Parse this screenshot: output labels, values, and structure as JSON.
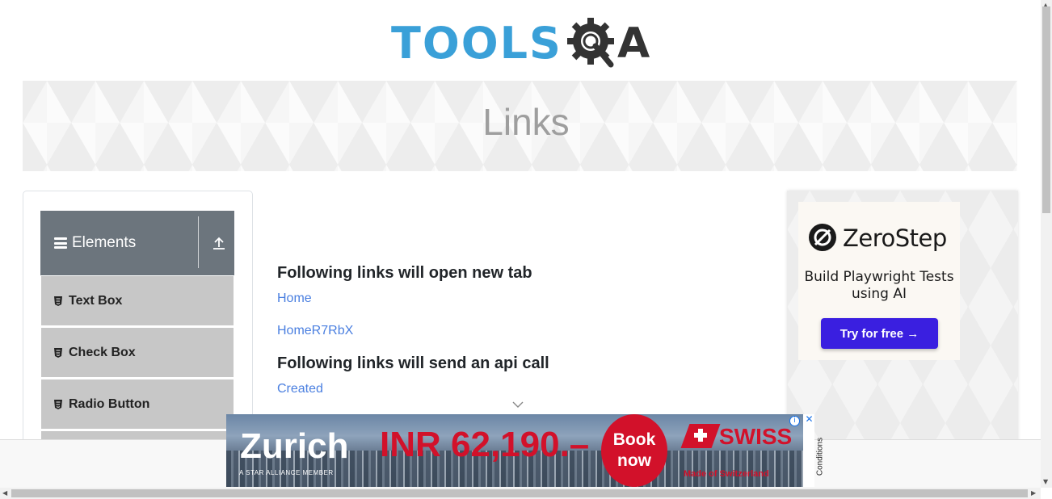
{
  "header": {
    "logo_tools": "TOOLS",
    "logo_a": "A"
  },
  "banner": {
    "title": "Links"
  },
  "sidebar": {
    "group_title": "Elements",
    "items": [
      {
        "label": "Text Box"
      },
      {
        "label": "Check Box"
      },
      {
        "label": "Radio Button"
      }
    ]
  },
  "main": {
    "sections": [
      {
        "heading": "Following links will open new tab",
        "links": [
          "Home",
          "HomeR7RbX"
        ]
      },
      {
        "heading": "Following links will send an api call",
        "links": [
          "Created"
        ]
      }
    ]
  },
  "right_ad": {
    "brand": "ZeroStep",
    "tagline": "Build Playwright Tests using AI",
    "cta": "Try for free →"
  },
  "bottom_ad": {
    "city": "Zurich",
    "price": "INR 62,190.–",
    "book_line1": "Book",
    "book_line2": "now",
    "airline": "SWISS",
    "alliance": "A STAR ALLIANCE MEMBER",
    "tagline": "Made of Switzerland",
    "conditions": "Conditions",
    "info_icon": "i",
    "close_icon": "✕"
  },
  "colors": {
    "link": "#4a7fe0",
    "sidebar_header": "#6c757d",
    "sidebar_item": "#c7c7c7",
    "cta": "#3a1fe0",
    "swiss_red": "#d2112a",
    "logo_blue": "#3aa0d8"
  }
}
